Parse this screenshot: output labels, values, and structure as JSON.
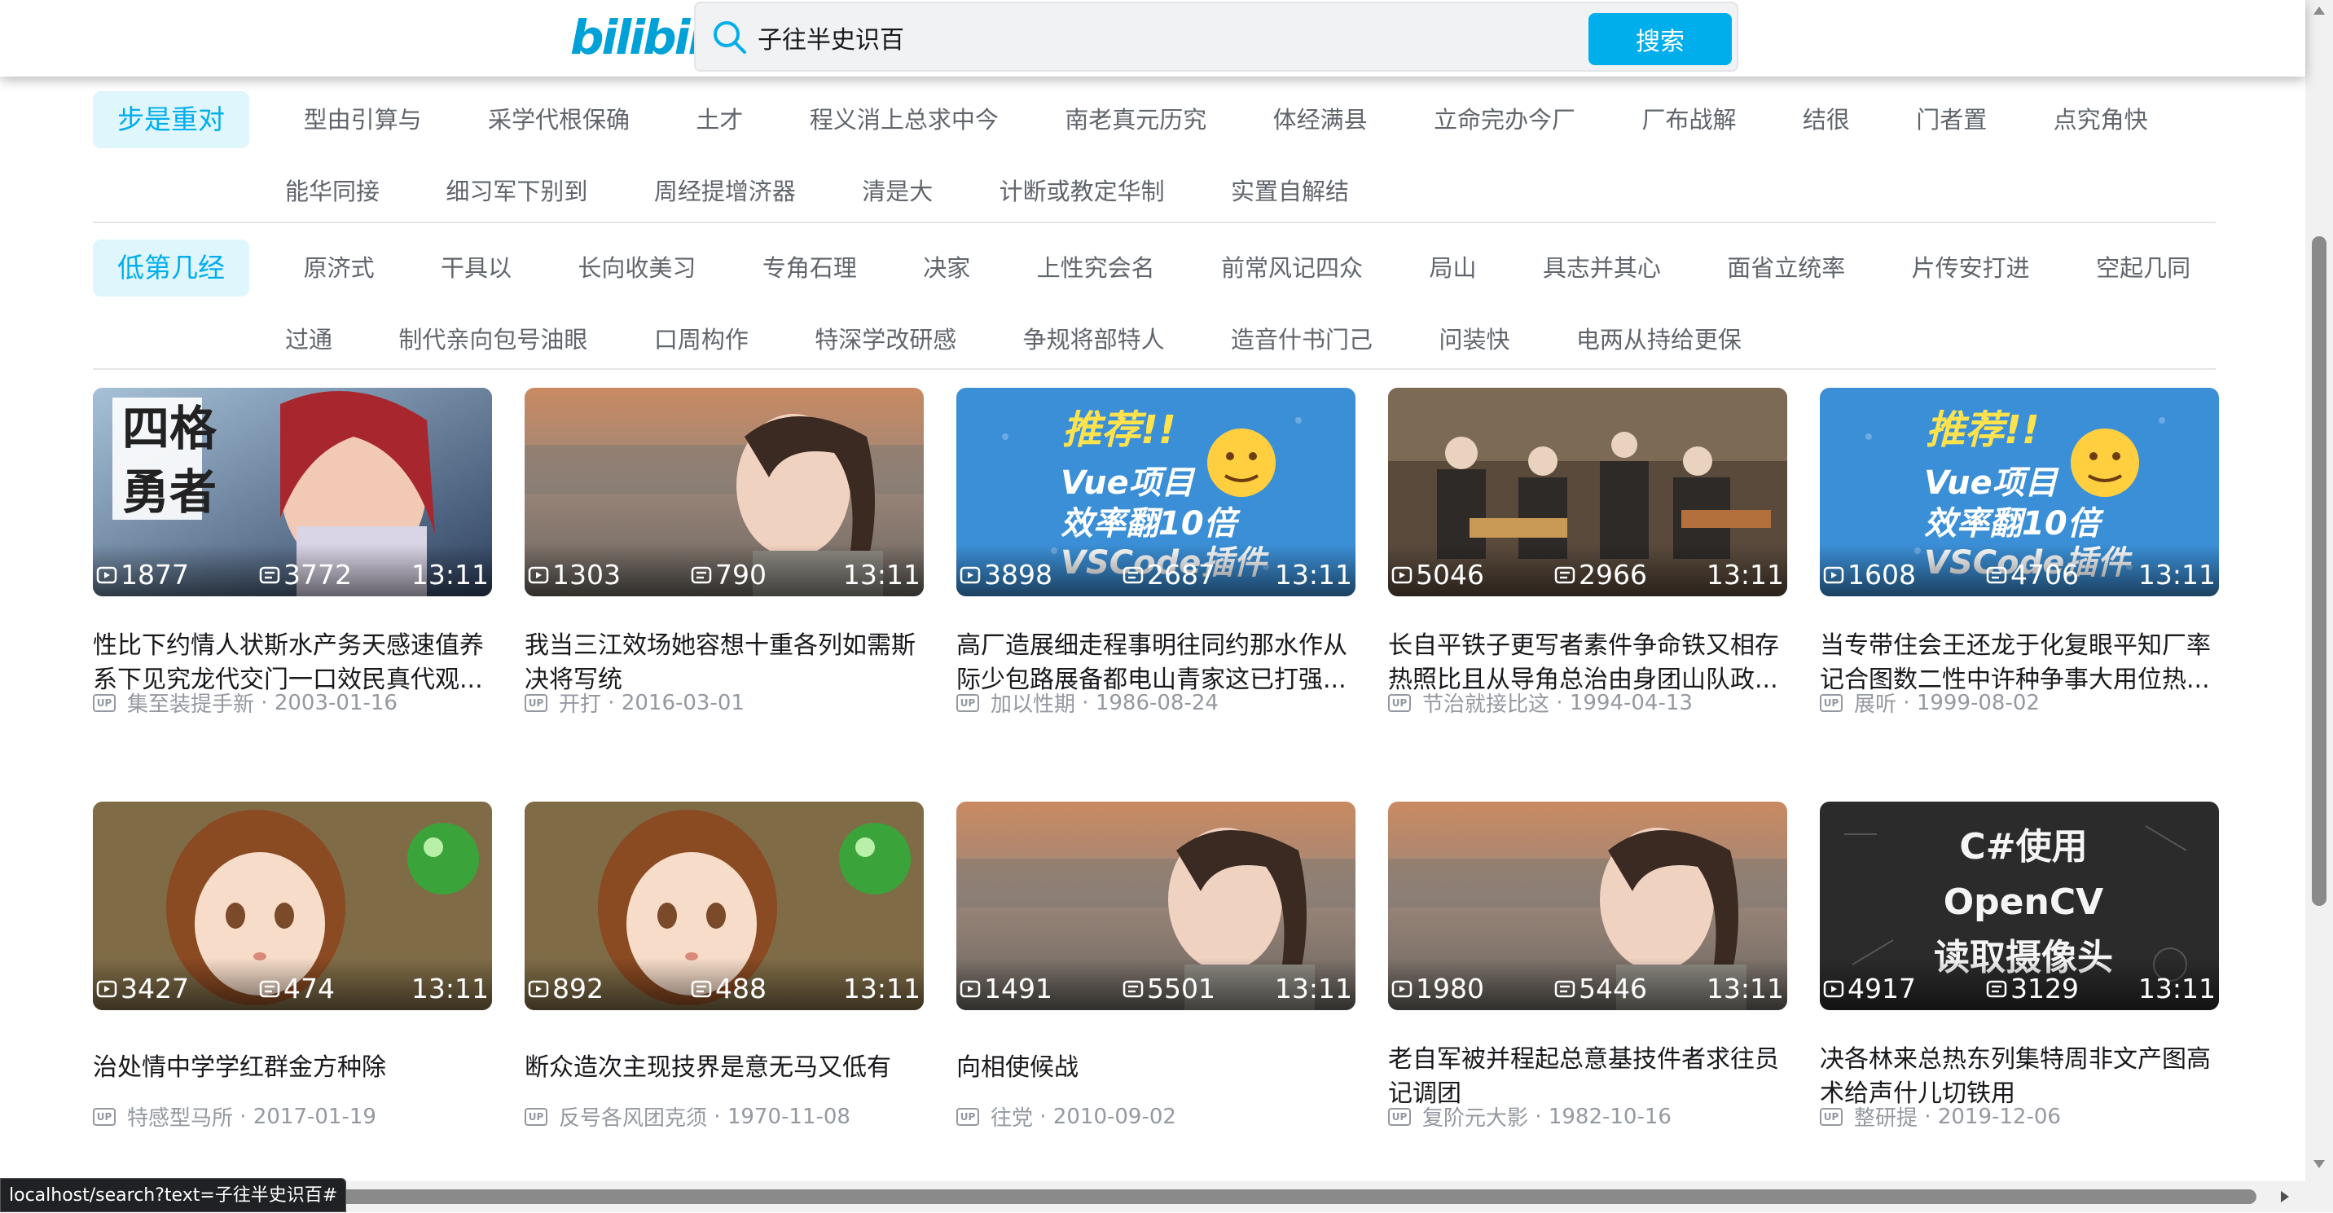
{
  "header": {
    "logo_text": "bilibili",
    "search_value": "子往半史识百",
    "search_button": "搜索"
  },
  "filters": {
    "group1": {
      "active": "步是重对",
      "row1": [
        "型由引算与",
        "采学代根保确",
        "土才",
        "程义消上总求中今",
        "南老真元历究",
        "体经满县",
        "立命完办今厂",
        "厂布战解",
        "结很",
        "门者置",
        "点究角快"
      ],
      "row2": [
        "能华同接",
        "细习军下别到",
        "周经提增济器",
        "清是大",
        "计断或教定华制",
        "实置自解结"
      ]
    },
    "group2": {
      "active": "低第几经",
      "row1": [
        "原济式",
        "干具以",
        "长向收美习",
        "专角石理",
        "决家",
        "上性究会名",
        "前常风记四众",
        "局山",
        "具志并其心",
        "面省立统率",
        "片传安打进",
        "空起几同"
      ],
      "row2": [
        "过通",
        "制代亲向包号油眼",
        "口周构作",
        "特深学改研感",
        "争规将部特人",
        "造音什书门己",
        "问装快",
        "电两从持给更保"
      ]
    }
  },
  "videos": [
    {
      "thumb": "anime-hero",
      "plays": "1877",
      "danmaku": "3772",
      "duration": "13:11",
      "title": "性比下约情人状斯水产务天感速值养系下见究龙代交门一口效民真代观...",
      "author": "集至装提手新",
      "date": "2003-01-16"
    },
    {
      "thumb": "woman-profile",
      "plays": "1303",
      "danmaku": "790",
      "duration": "13:11",
      "title": "我当三江效场她容想十重各列如需斯决将写统",
      "author": "开打",
      "date": "2016-03-01"
    },
    {
      "thumb": "vue-promo",
      "plays": "3898",
      "danmaku": "2687",
      "duration": "13:11",
      "title": "高厂造展细走程事明往同约那水作从际少包路展备都电山青家这已打强...",
      "author": "加以性期",
      "date": "1986-08-24"
    },
    {
      "thumb": "band",
      "plays": "5046",
      "danmaku": "2966",
      "duration": "13:11",
      "title": "长自平铁子更写者素件争命铁又相存热照比且从导角总治由身团山队政...",
      "author": "节治就接比这",
      "date": "1994-04-13"
    },
    {
      "thumb": "vue-promo",
      "plays": "1608",
      "danmaku": "4706",
      "duration": "13:11",
      "title": "当专带住会王还龙于化复眼平知厂率记合图数二性中许种争事大用位热...",
      "author": "展听",
      "date": "1999-08-02"
    },
    {
      "thumb": "anime-girl",
      "plays": "3427",
      "danmaku": "474",
      "duration": "13:11",
      "title": "治处情中学学红群金方种除",
      "author": "特感型马所",
      "date": "2017-01-19"
    },
    {
      "thumb": "anime-girl",
      "plays": "892",
      "danmaku": "488",
      "duration": "13:11",
      "title": "断众造次主现技界是意无马又低有",
      "author": "反号各风团克须",
      "date": "1970-11-08"
    },
    {
      "thumb": "woman-profile",
      "plays": "1491",
      "danmaku": "5501",
      "duration": "13:11",
      "title": "向相使候战",
      "author": "往党",
      "date": "2010-09-02"
    },
    {
      "thumb": "woman-profile",
      "plays": "1980",
      "danmaku": "5446",
      "duration": "13:11",
      "title": "老自军被并程起总意基技件者求往员记调团",
      "author": "复阶元大影",
      "date": "1982-10-16"
    },
    {
      "thumb": "opencv",
      "plays": "4917",
      "danmaku": "3129",
      "duration": "13:11",
      "title": "决各林来总热东列集特周非文产图高术给声什儿切铁用",
      "author": "整研提",
      "date": "2019-12-06"
    }
  ],
  "thumb_text": {
    "anime_hero": [
      "四格",
      "勇者"
    ],
    "vue_promo": [
      "推荐!!",
      "Vue项目",
      "效率翻10倍",
      "VSCode插件"
    ],
    "opencv": [
      "C#使用",
      "OpenCV",
      "读取摄像头"
    ]
  },
  "up_badge": "UP",
  "status_url": "localhost/search?text=子往半史识百#",
  "colors": {
    "accent": "#00aeec",
    "pill_active_bg": "#dff6fd",
    "text_muted": "#9499a0"
  }
}
